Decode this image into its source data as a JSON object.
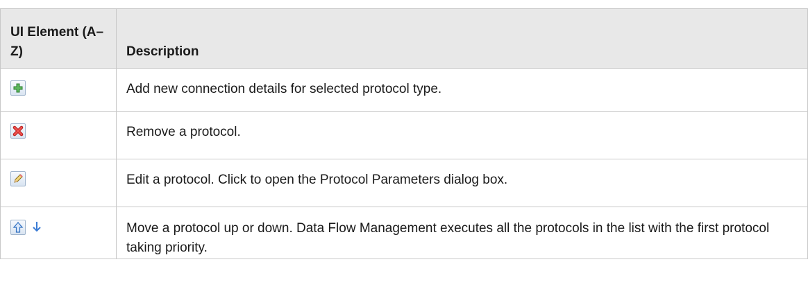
{
  "table": {
    "headers": {
      "ui_element": "UI Element (A–Z)",
      "description": "Description"
    },
    "rows": [
      {
        "icons": [
          "add-icon"
        ],
        "description": "Add new connection details for selected protocol type."
      },
      {
        "icons": [
          "remove-icon"
        ],
        "description": "Remove a protocol."
      },
      {
        "icons": [
          "edit-icon"
        ],
        "description": "Edit a protocol. Click to open the Protocol Parameters dialog box."
      },
      {
        "icons": [
          "move-up-icon",
          "move-down-icon"
        ],
        "description": "Move a protocol up or down. Data Flow Management executes all the protocols in the list with the first protocol taking priority."
      }
    ]
  }
}
